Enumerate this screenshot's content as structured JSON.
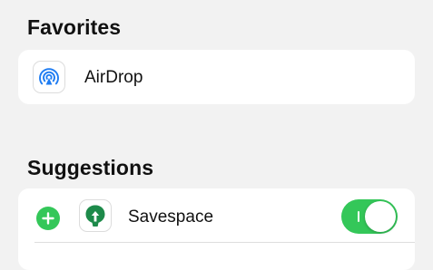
{
  "favorites": {
    "title": "Favorites",
    "items": [
      {
        "label": "AirDrop",
        "icon": "airdrop-icon"
      }
    ]
  },
  "suggestions": {
    "title": "Suggestions",
    "items": [
      {
        "label": "Savespace",
        "icon": "savespace-icon",
        "add_icon": "plus-icon",
        "toggle_on": true
      }
    ]
  },
  "colors": {
    "background": "#f2f2f2",
    "card": "#ffffff",
    "accent_green": "#34c759",
    "airdrop_blue": "#1e7cf2",
    "savespace_green": "#1d8a4a"
  }
}
